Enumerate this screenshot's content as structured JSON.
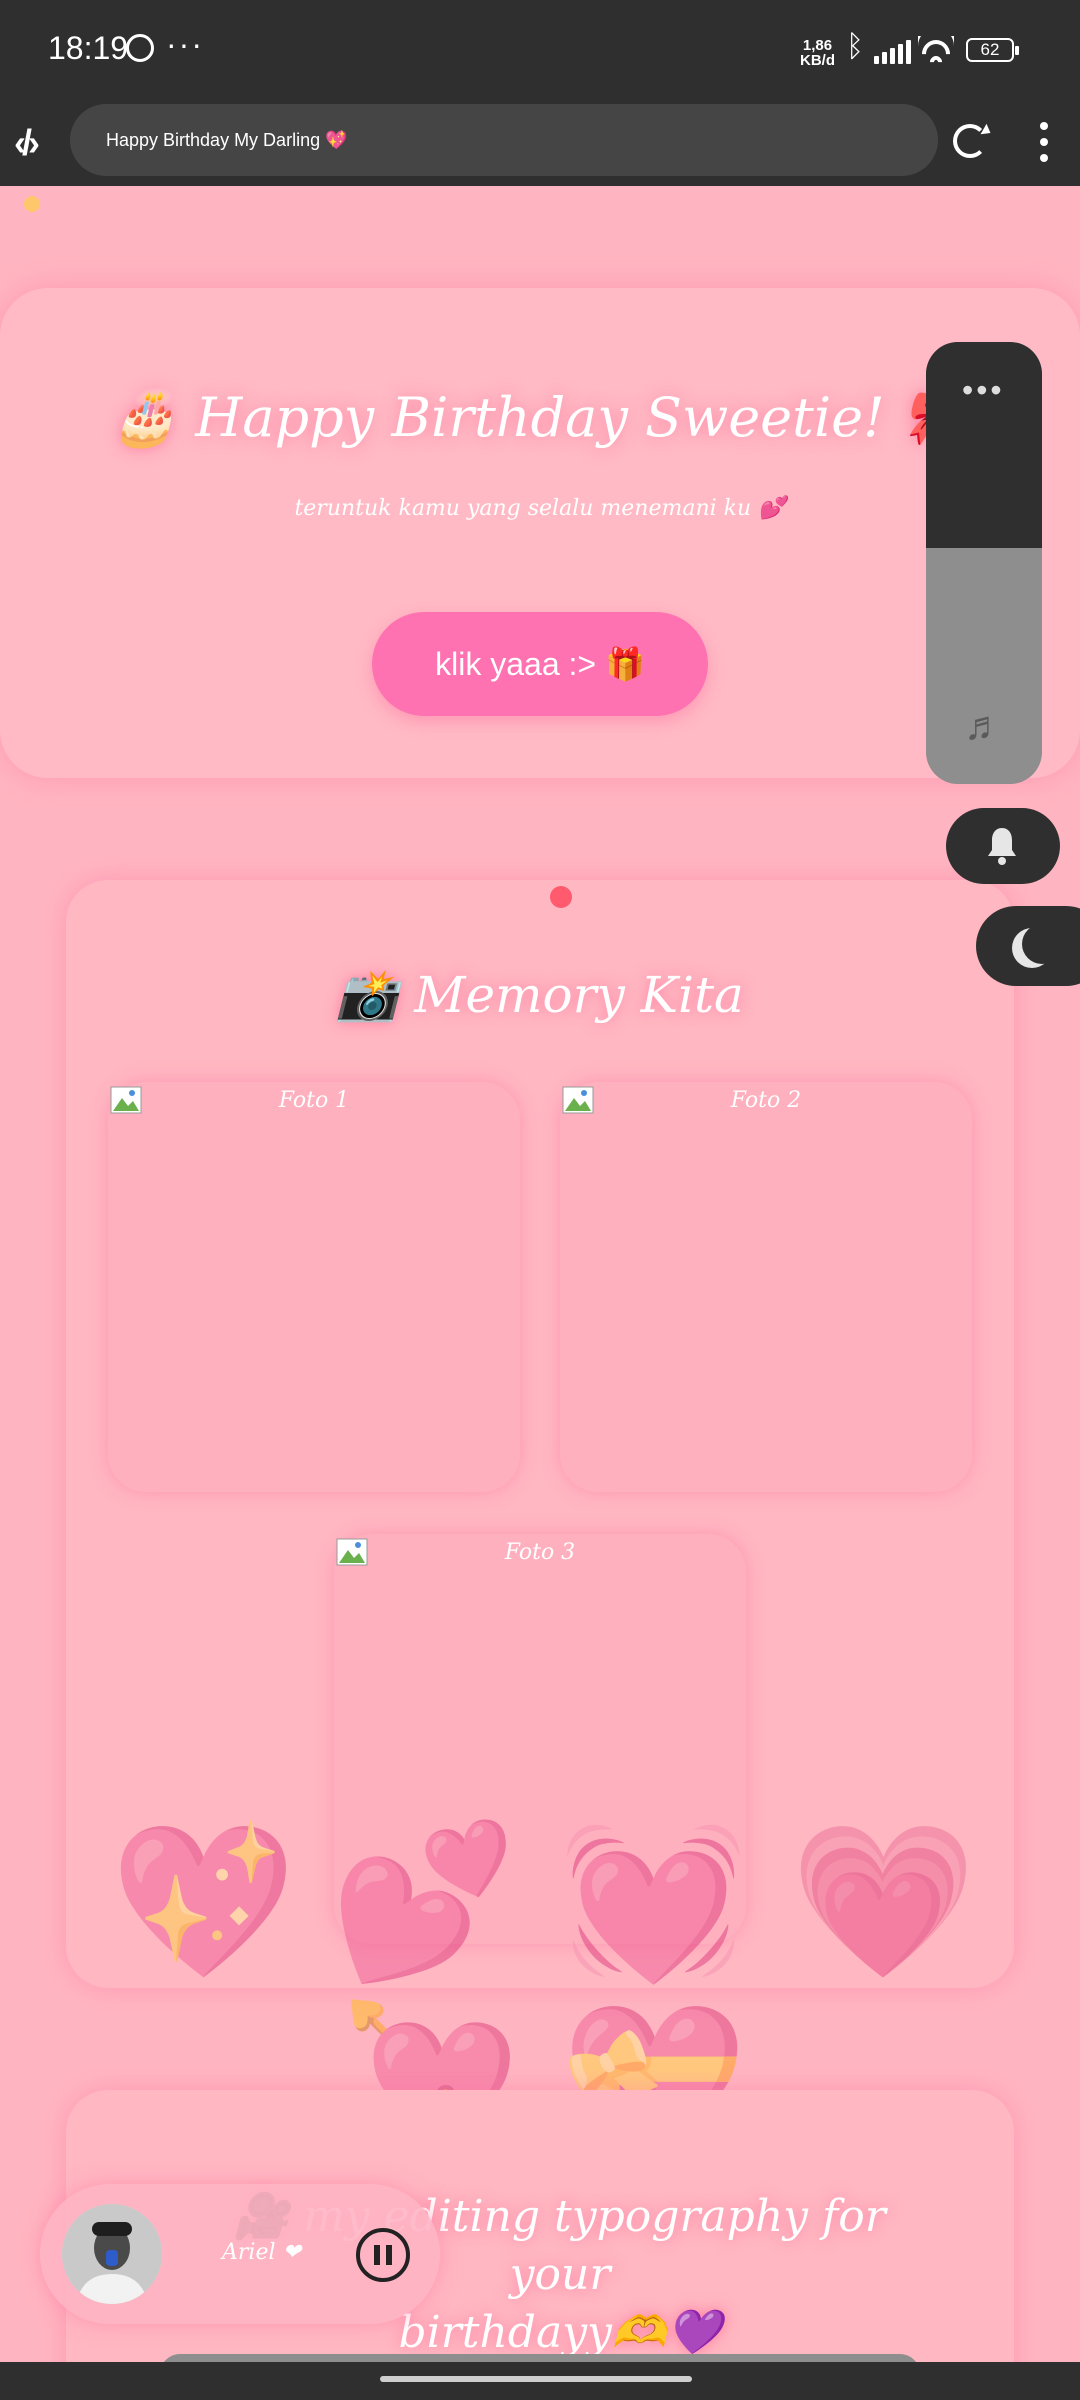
{
  "status_bar": {
    "time": "18:19",
    "more": "···",
    "speed_value": "1,86",
    "speed_unit": "KB/d",
    "battery": "62"
  },
  "browser": {
    "url_title": "Happy Birthday My Darling 💖"
  },
  "hero": {
    "title": "🎂 Happy Birthday Sweetie! 🎀",
    "subtitle": "teruntuk kamu yang selalu menemani ku 💕",
    "button_label": "klik yaaa :> 🎁"
  },
  "memory": {
    "title": "📸 Memory Kita",
    "photos": [
      {
        "label": "Foto 1"
      },
      {
        "label": "Foto 2"
      },
      {
        "label": "Foto 3"
      }
    ]
  },
  "floating_hearts": [
    "💖",
    "💕",
    "💓",
    "💗",
    "💘",
    "💝"
  ],
  "bottom": {
    "title_line1": "🎥 my editing typography for your",
    "title_line2": "birthdayy🫶💜"
  },
  "side_panel": {
    "dots": "•••",
    "music": "♬"
  },
  "player": {
    "name": "Ariel ❤"
  },
  "colors": {
    "background": "#ffb5c1",
    "accent_button": "#ff72b1",
    "dark_ui": "#2f2f2f"
  }
}
